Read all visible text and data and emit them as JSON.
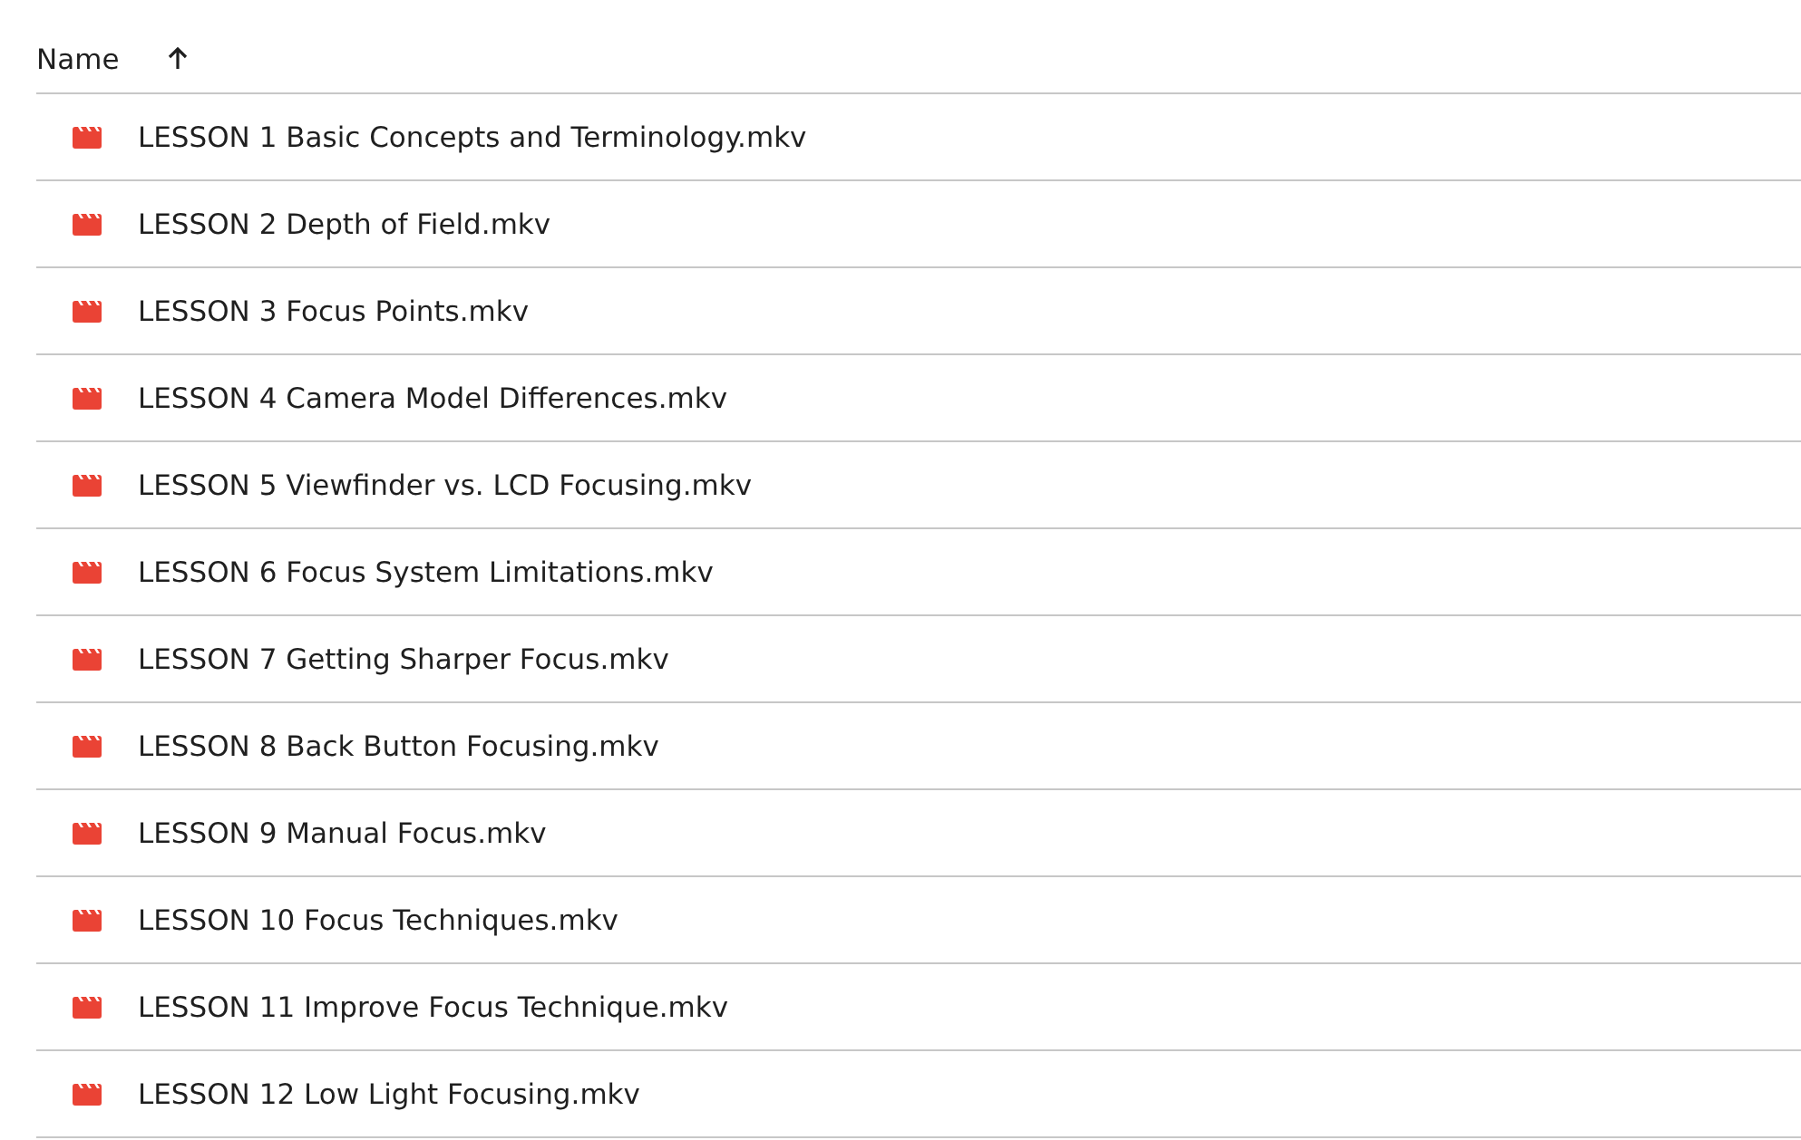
{
  "header": {
    "label": "Name",
    "sort_ascending": true
  },
  "files": [
    {
      "name": "LESSON 1 Basic Concepts and Terminology.mkv",
      "kind": "video"
    },
    {
      "name": "LESSON 2 Depth of Field.mkv",
      "kind": "video"
    },
    {
      "name": "LESSON 3 Focus Points.mkv",
      "kind": "video"
    },
    {
      "name": "LESSON 4 Camera Model Differences.mkv",
      "kind": "video"
    },
    {
      "name": "LESSON 5 Viewfinder vs. LCD Focusing.mkv",
      "kind": "video"
    },
    {
      "name": "LESSON 6 Focus System Limitations.mkv",
      "kind": "video"
    },
    {
      "name": "LESSON 7 Getting Sharper Focus.mkv",
      "kind": "video"
    },
    {
      "name": "LESSON 8 Back Button Focusing.mkv",
      "kind": "video"
    },
    {
      "name": "LESSON 9 Manual Focus.mkv",
      "kind": "video"
    },
    {
      "name": "LESSON 10 Focus Techniques.mkv",
      "kind": "video"
    },
    {
      "name": "LESSON 11 Improve Focus Technique.mkv",
      "kind": "video"
    },
    {
      "name": "LESSON 12 Low Light Focusing.mkv",
      "kind": "video"
    }
  ]
}
